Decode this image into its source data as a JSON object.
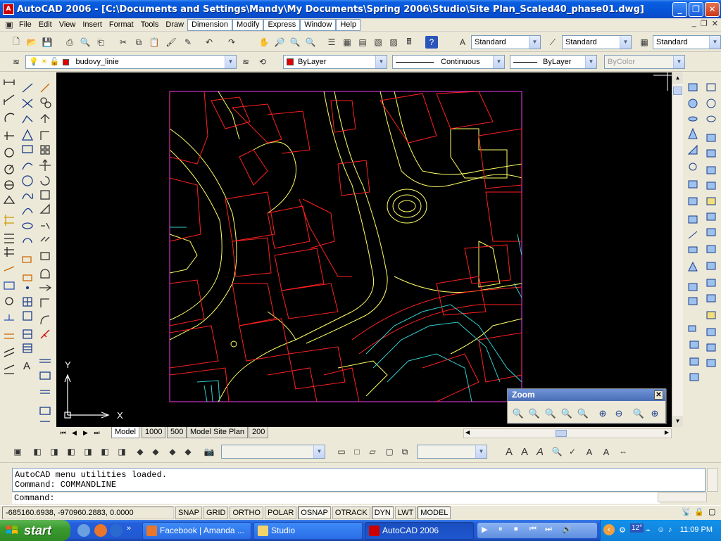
{
  "window": {
    "title": "AutoCAD 2006 - [C:\\Documents and Settings\\Mandy\\My Documents\\Spring 2006\\Studio\\Site Plan_Scaled40_phase01.dwg]",
    "app_icon_text": "A"
  },
  "menu": [
    "File",
    "Edit",
    "View",
    "Insert",
    "Format",
    "Tools",
    "Draw",
    "Dimension",
    "Modify",
    "Express",
    "Window",
    "Help"
  ],
  "styles_toolbar": {
    "text_style": "Standard",
    "dim_style": "Standard",
    "table_style": "Standard"
  },
  "layers_toolbar": {
    "current_layer": "budovy_linie",
    "color": "ByLayer",
    "linetype": "Continuous",
    "lineweight": "ByLayer",
    "plot_style": "ByColor"
  },
  "layout_tabs": [
    "Model",
    "1000",
    "500",
    "Model Site Plan",
    "200"
  ],
  "active_tab": "Model",
  "ucs": {
    "x_label": "X",
    "y_label": "Y"
  },
  "zoom_toolbar": {
    "title": "Zoom",
    "close_glyph": "✕"
  },
  "command_line": {
    "history": [
      "AutoCAD menu utilities loaded.",
      "Command: COMMANDLINE"
    ],
    "prompt": "Command:"
  },
  "status_bar": {
    "coordinates": "-685160.6938, -970960.2883, 0.0000",
    "toggles": [
      "SNAP",
      "GRID",
      "ORTHO",
      "POLAR",
      "OSNAP",
      "OTRACK",
      "DYN",
      "LWT",
      "MODEL"
    ]
  },
  "taskbar": {
    "start_label": "start",
    "tasks": [
      {
        "label": "Facebook | Amanda ...",
        "icon": "firefox-icon"
      },
      {
        "label": "Studio",
        "icon": "folder-icon"
      },
      {
        "label": "AutoCAD 2006",
        "icon": "autocad-icon"
      }
    ],
    "clock": "11:09 PM",
    "tray_temp": "12°"
  },
  "colors": {
    "drawing_bg": "#000000",
    "building_lines": "#ff2020",
    "road_lines": "#ffff66",
    "cyan_lines": "#33cccc",
    "viewport_border": "#cc33cc"
  }
}
